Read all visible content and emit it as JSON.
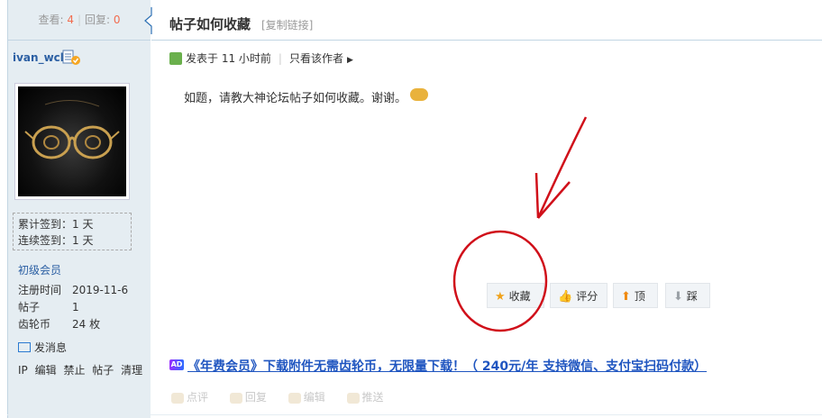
{
  "left": {
    "views_label": "查看:",
    "views": "4",
    "replies_label": "回复:",
    "replies": "0",
    "username": "ivan_wcl",
    "checkin_total": "累计签到：1 天",
    "checkin_streak": "连续签到：1 天",
    "grade": "初级会员",
    "info": [
      {
        "k": "注册时间",
        "v": "2019-11-6"
      },
      {
        "k": "帖子",
        "v": "1"
      },
      {
        "k": "齿轮币",
        "v": "24 枚"
      }
    ],
    "send_message": "发消息",
    "admin_links": [
      "IP",
      "编辑",
      "禁止",
      "帖子",
      "清理"
    ]
  },
  "header": {
    "title": "帖子如何收藏",
    "copy_link": "[复制链接]"
  },
  "post": {
    "posted": "发表于 11 小时前",
    "only_author": "只看该作者",
    "content": "如题，请教大神论坛帖子如何收藏。谢谢。"
  },
  "actions": [
    {
      "label": "收藏",
      "icon": "star-icon",
      "glyph": "★",
      "color": "#f0a21b"
    },
    {
      "label": "评分",
      "icon": "thumb-icon",
      "glyph": "👍",
      "color": "#e0a050"
    },
    {
      "label": "顶",
      "icon": "arrow-up-icon",
      "glyph": "⬆",
      "color": "#f08a10"
    },
    {
      "label": "踩",
      "icon": "arrow-down-icon",
      "glyph": "⬇",
      "color": "#9aa0a6"
    }
  ],
  "ad": {
    "tag": "AD",
    "text": "《年费会员》下载附件无需齿轮币，无限量下载！（ 240元/年  支持微信、支付宝扫码付款）"
  },
  "footer": [
    "点评",
    "回复",
    "编辑",
    "推送"
  ],
  "colors": {
    "annotation": "#d0101a",
    "link": "#2b5fa3",
    "accent": "#f26c4f"
  }
}
